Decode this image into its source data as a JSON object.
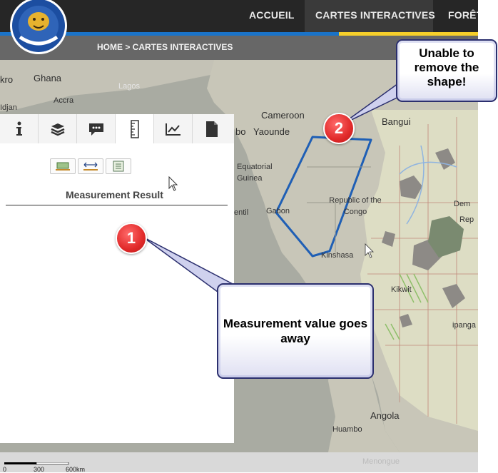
{
  "nav": {
    "items": [
      "ACCUEIL",
      "CARTES INTERACTIVES",
      "FORÊT"
    ],
    "active": "CARTES INTERACTIVES"
  },
  "breadcrumb": "HOME > CARTES INTERACTIVES",
  "map": {
    "labels": [
      "Ghana",
      "Accra",
      "Lagos",
      "Cameroon",
      "Yaounde",
      "Bangui",
      "Equatorial Guinea",
      "Gabon",
      "Republic of the Congo",
      "Kinshasa",
      "Kikwit",
      "Angola",
      "Huambo",
      "Menongue",
      "kro",
      "Idjan",
      "bo",
      "entil",
      "Dem",
      "Rep",
      "ipanga"
    ]
  },
  "panel": {
    "tabs": [
      "info-icon",
      "layers-icon",
      "comment-icon",
      "ruler-icon",
      "chart-icon",
      "document-icon"
    ],
    "active_tab": "ruler-icon",
    "tools": [
      "area-measure-icon",
      "distance-measure-icon",
      "location-measure-icon"
    ],
    "result_label": "Measurement Result"
  },
  "scale": {
    "labels": [
      "0",
      "300",
      "600km"
    ]
  },
  "callouts": {
    "one": {
      "number": "1",
      "text": "Measurement value goes away"
    },
    "two": {
      "number": "2",
      "text": "Unable to remove the shape!"
    }
  },
  "colors": {
    "header": "#262626",
    "accent_blue": "#1a73c8",
    "accent_yellow": "#f6cf2a",
    "shape_stroke": "#1f5fb5",
    "badge": "#e12a2a"
  }
}
